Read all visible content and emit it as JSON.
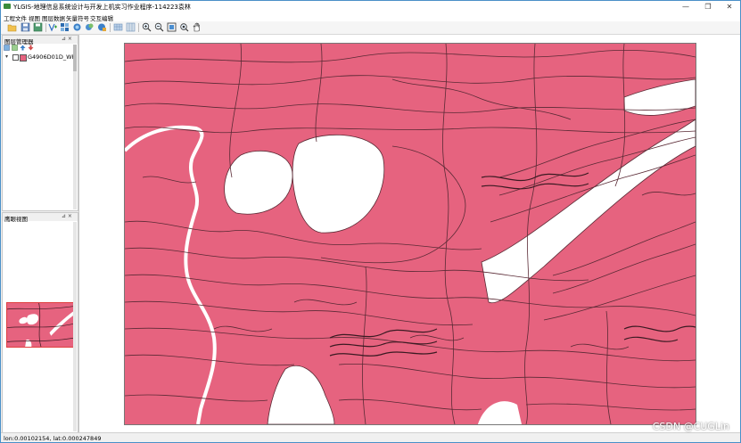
{
  "window": {
    "title": "YLGIS-地理信息系统设计与开发上机实习作业程序-114223袁林",
    "min": "—",
    "max": "❐",
    "close": "✕"
  },
  "menu": {
    "items": [
      "工程文件",
      "视图",
      "图层数据",
      "矢量符号",
      "交互编辑"
    ]
  },
  "toolbar": {
    "buttons": [
      "open-folder",
      "save",
      "save-as",
      "add-vector-layer",
      "add-raster-layer",
      "layer-style",
      "layer-properties",
      "table-view",
      "attribute-view",
      "zoom-in",
      "zoom-out",
      "full-extent",
      "zoom-layer",
      "pan"
    ]
  },
  "layer_panel": {
    "title": "图层管理器",
    "pin": "⊿ ×",
    "layers": [
      {
        "name": "G4906D01D_WP",
        "checked": true,
        "color": "#e6637f"
      }
    ]
  },
  "overview_panel": {
    "title": "鹰眼视图",
    "pin": "⊿ ×"
  },
  "status": {
    "coords": "lon:0.00102154, lat:0.000247849"
  },
  "watermark": "CSDN @CUGLin",
  "colors": {
    "polygon_fill": "#e6637f",
    "outline": "#5a2a35",
    "background": "#ffffff"
  }
}
